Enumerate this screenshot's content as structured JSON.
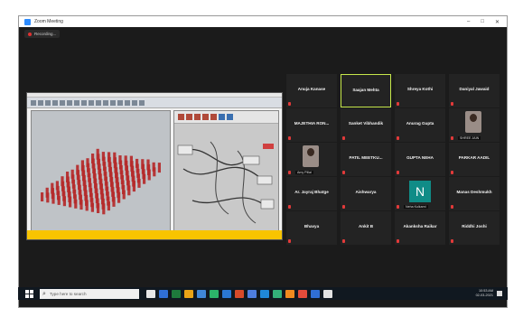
{
  "window": {
    "title": "Zoom Meeting",
    "controls": [
      "–",
      "□",
      "✕"
    ]
  },
  "recording": {
    "label": "Recording..."
  },
  "shared_screen": {
    "pillar_rows": 12,
    "pillar_cols": 12,
    "pillar_color": "#b52a2a"
  },
  "participants": [
    {
      "name": "Anuja Kanase",
      "row": 0,
      "col": 0,
      "muted": true
    },
    {
      "name": "Saajan Mehta",
      "row": 0,
      "col": 1,
      "muted": false,
      "active": true
    },
    {
      "name": "Shreya Kothi",
      "row": 0,
      "col": 2,
      "muted": true
    },
    {
      "name": "Daniyal Jawaid",
      "row": 0,
      "col": 3,
      "muted": true
    },
    {
      "name": "MAJETHIA RON...",
      "row": 1,
      "col": 0,
      "muted": true
    },
    {
      "name": "Sanket Vibhandik",
      "row": 1,
      "col": 1,
      "muted": true
    },
    {
      "name": "Anurag Gupta",
      "row": 1,
      "col": 2,
      "muted": true
    },
    {
      "name": "",
      "row": 1,
      "col": 3,
      "muted": true,
      "video": true,
      "label": "SHREE JAIN"
    },
    {
      "name": "",
      "row": 2,
      "col": 0,
      "muted": true,
      "video": true,
      "label": "Amy Pillai"
    },
    {
      "name": "PATIL MEETKU...",
      "row": 2,
      "col": 1,
      "muted": true
    },
    {
      "name": "GUPTA NEHA",
      "row": 2,
      "col": 2,
      "muted": true
    },
    {
      "name": "PARKAR AADIL",
      "row": 2,
      "col": 3,
      "muted": true
    },
    {
      "name": "Ar. Jayraj Bhatge",
      "row": 3,
      "col": 0,
      "muted": true
    },
    {
      "name": "Aishwarya",
      "row": 3,
      "col": 1,
      "muted": true
    },
    {
      "name": "",
      "row": 3,
      "col": 2,
      "muted": true,
      "letter": "N",
      "label": "Neha Kulkarni"
    },
    {
      "name": "Manas Deshmukh",
      "row": 3,
      "col": 3,
      "muted": true
    },
    {
      "name": "Bhavya",
      "row": 4,
      "col": 0,
      "muted": true
    },
    {
      "name": "Ankit B",
      "row": 4,
      "col": 1,
      "muted": true
    },
    {
      "name": "Akanksha Raikar",
      "row": 4,
      "col": 2,
      "muted": true
    },
    {
      "name": "Riddhi Joshi",
      "row": 4,
      "col": 3,
      "muted": true
    }
  ],
  "taskbar": {
    "search_placeholder": "Type here to search",
    "time": "10:53 AM",
    "date": "02-03-2021",
    "app_colors": [
      "#e7e7e7",
      "#2f6fd6",
      "#1e7a3c",
      "#e8a317",
      "#3f87d8",
      "#2bb36b",
      "#2a78d4",
      "#d64a2a",
      "#4d7ee0",
      "#1f88d8",
      "#33b07a",
      "#f08a1f",
      "#e24b3b",
      "#2f6fd6",
      "#e2e2e2"
    ]
  }
}
